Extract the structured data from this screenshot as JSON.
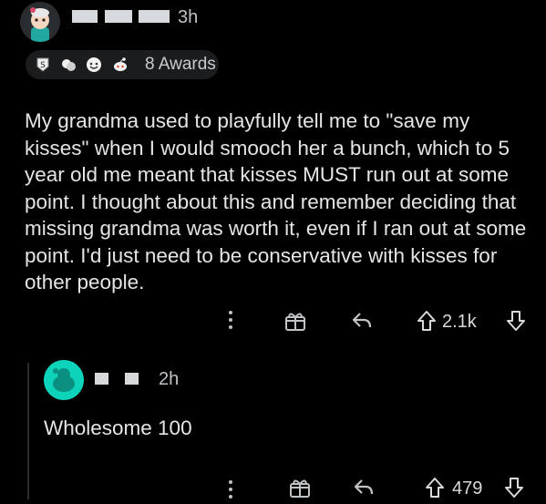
{
  "comment": {
    "time": "3h",
    "awards_label": "8 Awards",
    "text": "My grandma used to playfully tell me to \"save my kisses\" when I would smooch her a bunch, which to 5 year old me meant that kisses MUST run out at some point. I thought about this and remember deciding that missing grandma was worth it, even if I ran out at some point. I'd just need to be conservative with kisses for other people.",
    "score": "2.1k"
  },
  "reply": {
    "time": "2h",
    "text": "Wholesome 100",
    "score": "479"
  },
  "colors": {
    "background": "#000000",
    "text": "#d7dadc",
    "reply_avatar": "#0dd3bb"
  }
}
